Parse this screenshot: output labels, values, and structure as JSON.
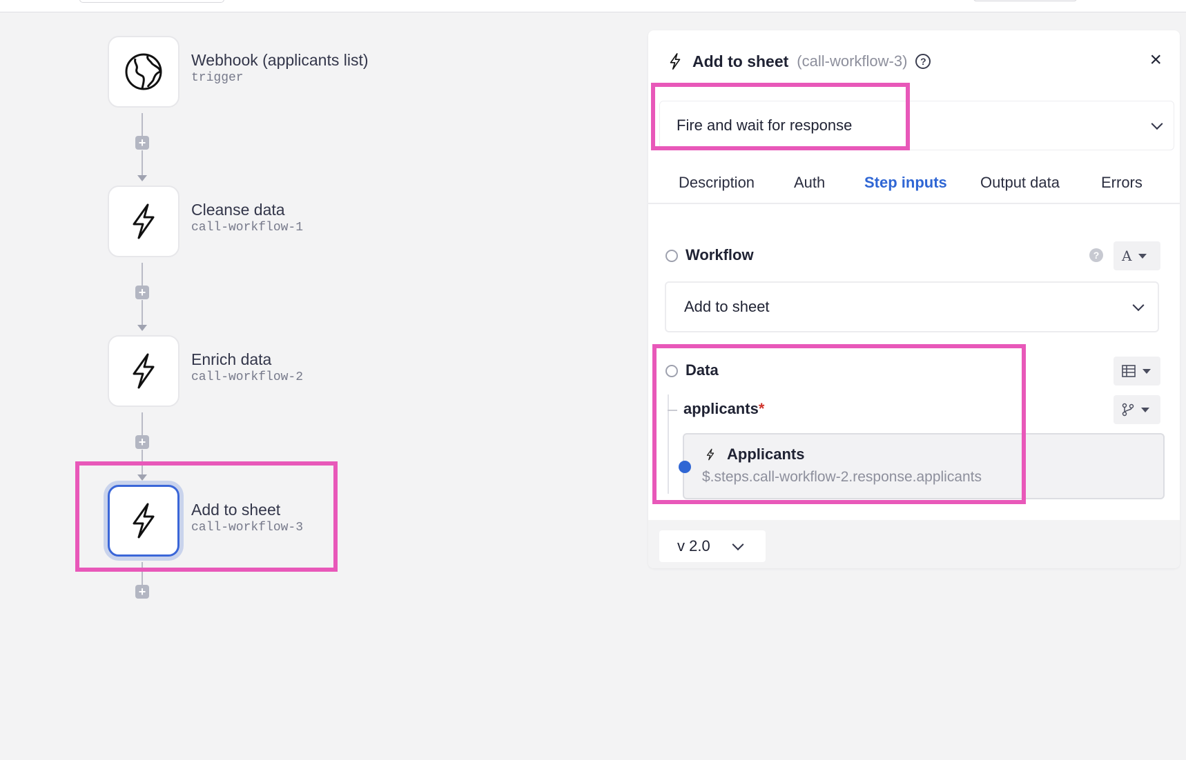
{
  "canvas": {
    "steps": [
      {
        "title": "Webhook (applicants list)",
        "subtitle": "trigger",
        "icon": "globe-icon"
      },
      {
        "title": "Cleanse data",
        "subtitle": "call-workflow-1",
        "icon": "lightning-icon"
      },
      {
        "title": "Enrich data",
        "subtitle": "call-workflow-2",
        "icon": "lightning-icon"
      },
      {
        "title": "Add to sheet",
        "subtitle": "call-workflow-3",
        "icon": "lightning-icon",
        "selected": true
      }
    ],
    "add_step_glyph": "+"
  },
  "panel": {
    "title": "Add to sheet",
    "subtitle": "(call-workflow-3)",
    "help_glyph": "?",
    "close_glyph": "×",
    "mode_value": "Fire and wait for response",
    "tabs": [
      "Description",
      "Auth",
      "Step inputs",
      "Output data",
      "Errors"
    ],
    "active_tab": "Step inputs",
    "workflow_label": "Workflow",
    "workflow_value": "Add to sheet",
    "workflow_type_glyph": "A",
    "data_label": "Data",
    "applicants_label": "applicants",
    "required_mark": "*",
    "ref_title": "Applicants",
    "ref_path": "$.steps.call-workflow-2.response.applicants",
    "version": "v 2.0"
  },
  "colors": {
    "highlight": "#e858b9",
    "accent": "#2f66d4",
    "background": "#f3f3f4"
  }
}
